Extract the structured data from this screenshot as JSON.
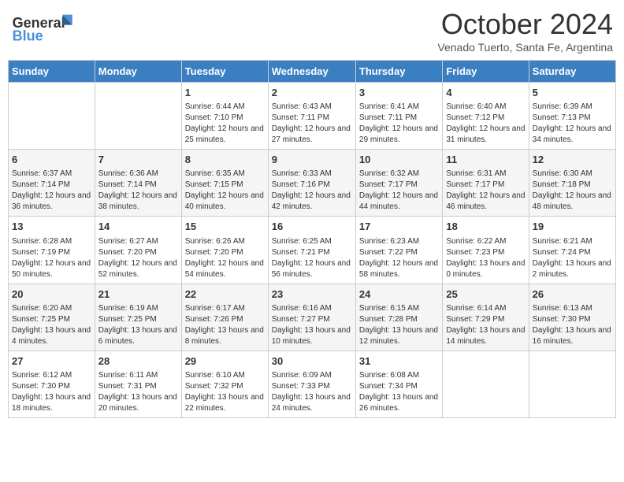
{
  "header": {
    "logo_general": "General",
    "logo_blue": "Blue",
    "title": "October 2024",
    "location": "Venado Tuerto, Santa Fe, Argentina"
  },
  "days_of_week": [
    "Sunday",
    "Monday",
    "Tuesday",
    "Wednesday",
    "Thursday",
    "Friday",
    "Saturday"
  ],
  "weeks": [
    [
      {
        "day": "",
        "info": ""
      },
      {
        "day": "",
        "info": ""
      },
      {
        "day": "1",
        "info": "Sunrise: 6:44 AM\nSunset: 7:10 PM\nDaylight: 12 hours and 25 minutes."
      },
      {
        "day": "2",
        "info": "Sunrise: 6:43 AM\nSunset: 7:11 PM\nDaylight: 12 hours and 27 minutes."
      },
      {
        "day": "3",
        "info": "Sunrise: 6:41 AM\nSunset: 7:11 PM\nDaylight: 12 hours and 29 minutes."
      },
      {
        "day": "4",
        "info": "Sunrise: 6:40 AM\nSunset: 7:12 PM\nDaylight: 12 hours and 31 minutes."
      },
      {
        "day": "5",
        "info": "Sunrise: 6:39 AM\nSunset: 7:13 PM\nDaylight: 12 hours and 34 minutes."
      }
    ],
    [
      {
        "day": "6",
        "info": "Sunrise: 6:37 AM\nSunset: 7:14 PM\nDaylight: 12 hours and 36 minutes."
      },
      {
        "day": "7",
        "info": "Sunrise: 6:36 AM\nSunset: 7:14 PM\nDaylight: 12 hours and 38 minutes."
      },
      {
        "day": "8",
        "info": "Sunrise: 6:35 AM\nSunset: 7:15 PM\nDaylight: 12 hours and 40 minutes."
      },
      {
        "day": "9",
        "info": "Sunrise: 6:33 AM\nSunset: 7:16 PM\nDaylight: 12 hours and 42 minutes."
      },
      {
        "day": "10",
        "info": "Sunrise: 6:32 AM\nSunset: 7:17 PM\nDaylight: 12 hours and 44 minutes."
      },
      {
        "day": "11",
        "info": "Sunrise: 6:31 AM\nSunset: 7:17 PM\nDaylight: 12 hours and 46 minutes."
      },
      {
        "day": "12",
        "info": "Sunrise: 6:30 AM\nSunset: 7:18 PM\nDaylight: 12 hours and 48 minutes."
      }
    ],
    [
      {
        "day": "13",
        "info": "Sunrise: 6:28 AM\nSunset: 7:19 PM\nDaylight: 12 hours and 50 minutes."
      },
      {
        "day": "14",
        "info": "Sunrise: 6:27 AM\nSunset: 7:20 PM\nDaylight: 12 hours and 52 minutes."
      },
      {
        "day": "15",
        "info": "Sunrise: 6:26 AM\nSunset: 7:20 PM\nDaylight: 12 hours and 54 minutes."
      },
      {
        "day": "16",
        "info": "Sunrise: 6:25 AM\nSunset: 7:21 PM\nDaylight: 12 hours and 56 minutes."
      },
      {
        "day": "17",
        "info": "Sunrise: 6:23 AM\nSunset: 7:22 PM\nDaylight: 12 hours and 58 minutes."
      },
      {
        "day": "18",
        "info": "Sunrise: 6:22 AM\nSunset: 7:23 PM\nDaylight: 13 hours and 0 minutes."
      },
      {
        "day": "19",
        "info": "Sunrise: 6:21 AM\nSunset: 7:24 PM\nDaylight: 13 hours and 2 minutes."
      }
    ],
    [
      {
        "day": "20",
        "info": "Sunrise: 6:20 AM\nSunset: 7:25 PM\nDaylight: 13 hours and 4 minutes."
      },
      {
        "day": "21",
        "info": "Sunrise: 6:19 AM\nSunset: 7:25 PM\nDaylight: 13 hours and 6 minutes."
      },
      {
        "day": "22",
        "info": "Sunrise: 6:17 AM\nSunset: 7:26 PM\nDaylight: 13 hours and 8 minutes."
      },
      {
        "day": "23",
        "info": "Sunrise: 6:16 AM\nSunset: 7:27 PM\nDaylight: 13 hours and 10 minutes."
      },
      {
        "day": "24",
        "info": "Sunrise: 6:15 AM\nSunset: 7:28 PM\nDaylight: 13 hours and 12 minutes."
      },
      {
        "day": "25",
        "info": "Sunrise: 6:14 AM\nSunset: 7:29 PM\nDaylight: 13 hours and 14 minutes."
      },
      {
        "day": "26",
        "info": "Sunrise: 6:13 AM\nSunset: 7:30 PM\nDaylight: 13 hours and 16 minutes."
      }
    ],
    [
      {
        "day": "27",
        "info": "Sunrise: 6:12 AM\nSunset: 7:30 PM\nDaylight: 13 hours and 18 minutes."
      },
      {
        "day": "28",
        "info": "Sunrise: 6:11 AM\nSunset: 7:31 PM\nDaylight: 13 hours and 20 minutes."
      },
      {
        "day": "29",
        "info": "Sunrise: 6:10 AM\nSunset: 7:32 PM\nDaylight: 13 hours and 22 minutes."
      },
      {
        "day": "30",
        "info": "Sunrise: 6:09 AM\nSunset: 7:33 PM\nDaylight: 13 hours and 24 minutes."
      },
      {
        "day": "31",
        "info": "Sunrise: 6:08 AM\nSunset: 7:34 PM\nDaylight: 13 hours and 26 minutes."
      },
      {
        "day": "",
        "info": ""
      },
      {
        "day": "",
        "info": ""
      }
    ]
  ]
}
